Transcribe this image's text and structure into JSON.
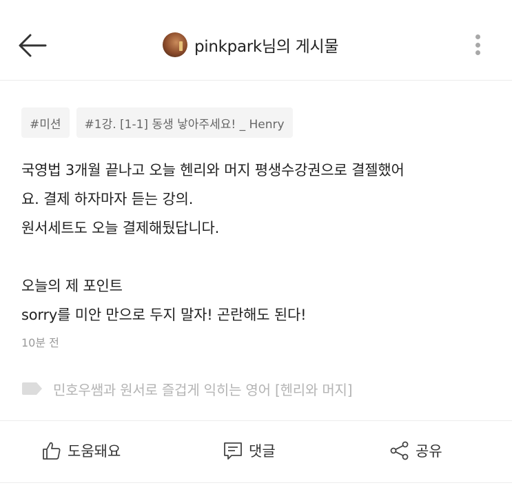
{
  "header": {
    "back_icon": "arrow-left-icon",
    "title": "pinkpark님의 게시물",
    "more_icon": "vertical-ellipsis-icon"
  },
  "tags": [
    "#미션",
    "#1강. [1-1] 동생 낳아주세요! _ Henry"
  ],
  "post": {
    "lines": [
      "국영법 3개월 끝나고 오늘 헨리와 머지 평생수강권으로 결젤했어",
      "요. 결제 하자마자 듣는 강의.",
      "원서세트도 오늘 결제해뒀답니다.",
      "",
      "오늘의 제 포인트",
      "sorry를 미안 만으로 두지 말자! 곤란해도 된다!"
    ],
    "time": "10분 전"
  },
  "category": {
    "icon": "tag-label-icon",
    "text": "민호우쌤과 원서로 즐겁게 익히는 영어 [헨리와 머지]"
  },
  "actions": {
    "like_label": "도움돼요",
    "comment_label": "댓글",
    "share_label": "공유"
  }
}
